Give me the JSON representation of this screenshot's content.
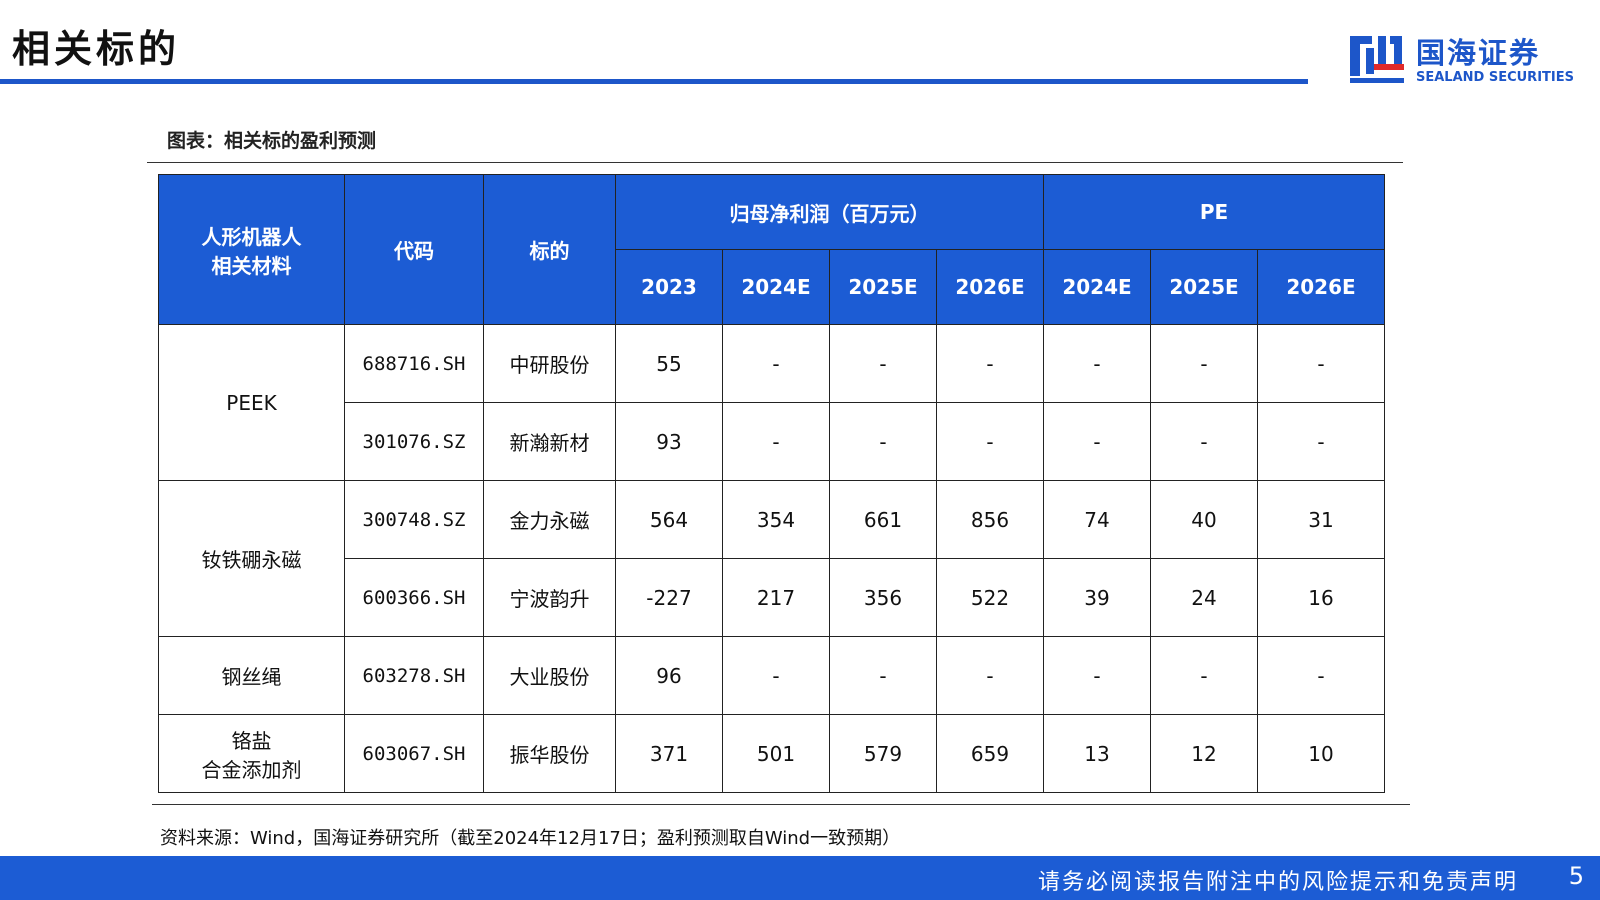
{
  "page": {
    "title": "相关标的",
    "logo_cn": "国海证券",
    "logo_en": "SEALAND SECURITIES",
    "brand_color": "#1c5cd4"
  },
  "figure": {
    "caption": "图表：相关标的盈利预测"
  },
  "table": {
    "headers": {
      "category": "人形机器人\n相关材料",
      "code": "代码",
      "name": "标的",
      "profit_group": "归母净利润（百万元）",
      "pe_group": "PE",
      "profit_years": [
        "2023",
        "2024E",
        "2025E",
        "2026E"
      ],
      "pe_years": [
        "2024E",
        "2025E",
        "2026E"
      ]
    },
    "rows": [
      {
        "category": "PEEK",
        "code": "688716.SH",
        "name": "中研股份",
        "profit": [
          "55",
          "-",
          "-",
          "-"
        ],
        "pe": [
          "-",
          "-",
          "-"
        ]
      },
      {
        "category": "PEEK",
        "code": "301076.SZ",
        "name": "新瀚新材",
        "profit": [
          "93",
          "-",
          "-",
          "-"
        ],
        "pe": [
          "-",
          "-",
          "-"
        ]
      },
      {
        "category": "钕铁硼永磁",
        "code": "300748.SZ",
        "name": "金力永磁",
        "profit": [
          "564",
          "354",
          "661",
          "856"
        ],
        "pe": [
          "74",
          "40",
          "31"
        ]
      },
      {
        "category": "钕铁硼永磁",
        "code": "600366.SH",
        "name": "宁波韵升",
        "profit": [
          "-227",
          "217",
          "356",
          "522"
        ],
        "pe": [
          "39",
          "24",
          "16"
        ]
      },
      {
        "category": "钢丝绳",
        "code": "603278.SH",
        "name": "大业股份",
        "profit": [
          "96",
          "-",
          "-",
          "-"
        ],
        "pe": [
          "-",
          "-",
          "-"
        ]
      },
      {
        "category": "铬盐\n合金添加剂",
        "code": "603067.SH",
        "name": "振华股份",
        "profit": [
          "371",
          "501",
          "579",
          "659"
        ],
        "pe": [
          "13",
          "12",
          "10"
        ]
      }
    ]
  },
  "source_note": "资料来源：Wind，国海证券研究所（截至2024年12月17日；盈利预测取自Wind一致预期）",
  "footer": {
    "disclaimer": "请务必阅读报告附注中的风险提示和免责声明",
    "page_number": "5"
  }
}
